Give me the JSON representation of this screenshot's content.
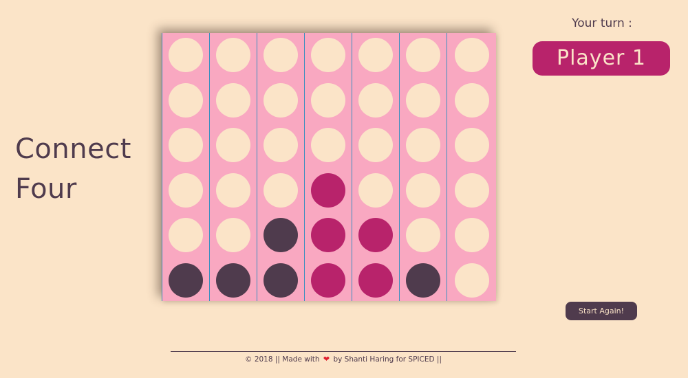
{
  "title": {
    "line1": "Connect",
    "line2": "Four"
  },
  "turn": {
    "label": "Your turn :",
    "player": "Player 1"
  },
  "restart_label": "Start Again!",
  "footer": {
    "before_heart": "© 2018 || Made with",
    "heart_icon": "heart-icon",
    "after_heart": "by Shanti Haring for SPICED ||"
  },
  "colors": {
    "background": "#fbe4c8",
    "board": "#f9a8c1",
    "empty_slot": "#fbe4c8",
    "player1": "#b8236b",
    "player2": "#4f3b4d",
    "column_divider": "#3b8fbf"
  },
  "board": {
    "columns": 7,
    "rows": 6,
    "grid": [
      [
        "empty",
        "empty",
        "empty",
        "empty",
        "empty",
        "empty",
        "empty"
      ],
      [
        "empty",
        "empty",
        "empty",
        "empty",
        "empty",
        "empty",
        "empty"
      ],
      [
        "empty",
        "empty",
        "empty",
        "empty",
        "empty",
        "empty",
        "empty"
      ],
      [
        "empty",
        "empty",
        "empty",
        "player1",
        "empty",
        "empty",
        "empty"
      ],
      [
        "empty",
        "empty",
        "player2",
        "player1",
        "player1",
        "empty",
        "empty"
      ],
      [
        "player2",
        "player2",
        "player2",
        "player1",
        "player1",
        "player2",
        "empty"
      ]
    ]
  }
}
